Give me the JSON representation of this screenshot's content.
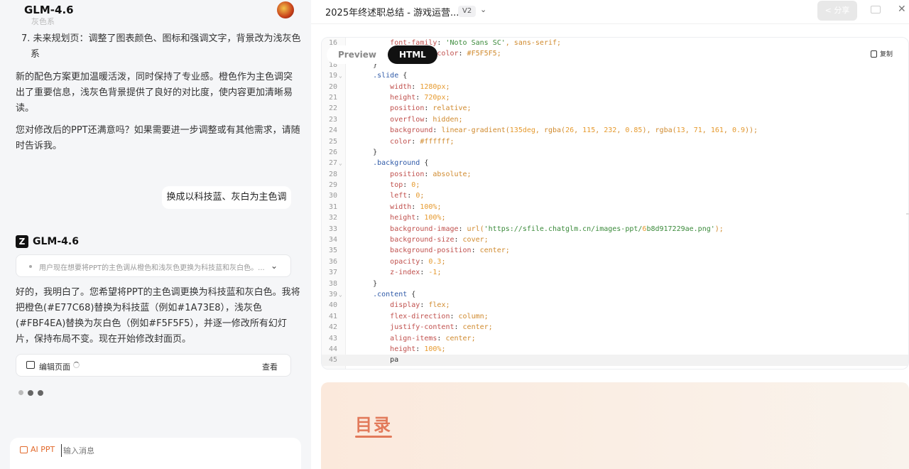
{
  "app": {
    "title": "GLM-4.6"
  },
  "chat": {
    "faded_tail": "灰色系",
    "item7_line1": "7. 未来规划页：调整了图表颜色、图标和强调文字，背景改为浅灰色",
    "item7_line2": "系",
    "summary_line1": "新的配色方案更加温暖活泼，同时保持了专业感。橙色作为主色调突",
    "summary_line2": "出了重要信息，浅灰色背景提供了良好的对比度，使内容更加清晰易",
    "summary_line3": "读。",
    "ask_line1": "您对修改后的PPT还满意吗？如果需要进一步调整或有其他需求，请随",
    "ask_line2": "时告诉我。",
    "user_message": "换成以科技蓝、灰白为主色调",
    "bot_name": "GLM-4.6",
    "bot_logo": "Z",
    "thinking_text": "用户现在想要将PPT的主色调从橙色和浅灰色更换为科技蓝和灰白色。...",
    "reply_line1": "好的，我明白了。您希望将PPT的主色调更换为科技蓝和灰白色。我将",
    "reply_line2": "把橙色(#E77C68)替换为科技蓝（例如#1A73E8），浅灰色",
    "reply_line3": "(#FBF4EA)替换为灰白色（例如#F5F5F5），并逐一修改所有幻灯",
    "reply_line4": "片，保持布局不变。现在开始修改封面页。",
    "edit_label": "编辑页面",
    "view_label": "查看",
    "input_mode": "AI PPT",
    "input_placeholder": "输入消息"
  },
  "viewer": {
    "doc_title": "2025年终述职总结 - 游戏运营...",
    "version": "V2",
    "share_label": "分享",
    "tabs": [
      "Preview",
      "HTML"
    ],
    "active_tab": "HTML",
    "copy_label": "复制",
    "code_lines": [
      {
        "n": "16",
        "t": "        font-family: 'Noto Sans SC', sans-serif;"
      },
      {
        "n": "17",
        "t": "        background-color: #F5F5F5;"
      },
      {
        "n": "18",
        "t": "    }"
      },
      {
        "n": "19",
        "t": "    .slide {",
        "fold": true
      },
      {
        "n": "20",
        "t": "        width: 1280px;"
      },
      {
        "n": "21",
        "t": "        height: 720px;"
      },
      {
        "n": "22",
        "t": "        position: relative;"
      },
      {
        "n": "23",
        "t": "        overflow: hidden;"
      },
      {
        "n": "24",
        "t": "        background: linear-gradient(135deg, rgba(26, 115, 232, 0.85), rgba(13, 71, 161, 0.9));"
      },
      {
        "n": "25",
        "t": "        color: #ffffff;"
      },
      {
        "n": "26",
        "t": "    }"
      },
      {
        "n": "27",
        "t": "    .background {",
        "fold": true
      },
      {
        "n": "28",
        "t": "        position: absolute;"
      },
      {
        "n": "29",
        "t": "        top: 0;"
      },
      {
        "n": "30",
        "t": "        left: 0;"
      },
      {
        "n": "31",
        "t": "        width: 100%;"
      },
      {
        "n": "32",
        "t": "        height: 100%;"
      },
      {
        "n": "33",
        "t": "        background-image: url('https://sfile.chatglm.cn/images-ppt/6b8d917229ae.png');"
      },
      {
        "n": "34",
        "t": "        background-size: cover;"
      },
      {
        "n": "35",
        "t": "        background-position: center;"
      },
      {
        "n": "36",
        "t": "        opacity: 0.3;"
      },
      {
        "n": "37",
        "t": "        z-index: -1;"
      },
      {
        "n": "38",
        "t": "    }"
      },
      {
        "n": "39",
        "t": "    .content {",
        "fold": true
      },
      {
        "n": "40",
        "t": "        display: flex;"
      },
      {
        "n": "41",
        "t": "        flex-direction: column;"
      },
      {
        "n": "42",
        "t": "        justify-content: center;"
      },
      {
        "n": "43",
        "t": "        align-items: center;"
      },
      {
        "n": "44",
        "t": "        height: 100%;"
      },
      {
        "n": "45",
        "t": "        pa",
        "active": true
      }
    ],
    "preview_heading": "目录"
  },
  "colors": {
    "accent_orange": "#e26a2c",
    "heading_coral": "#e27a5a"
  }
}
